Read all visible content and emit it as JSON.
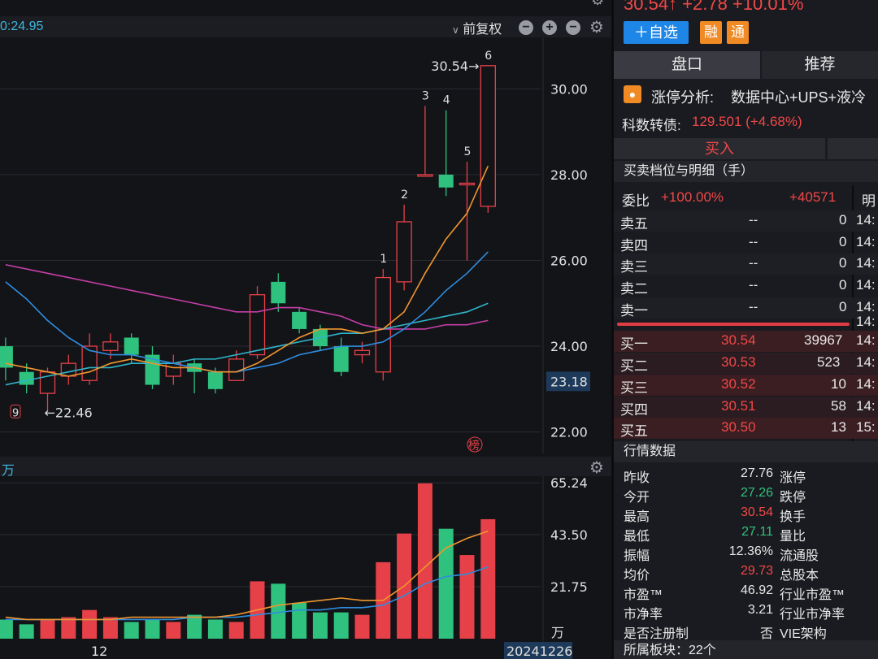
{
  "toolbar": {
    "left_value": "0:24.95",
    "adjust_label": "前复权",
    "settings_icon": "gear-icon"
  },
  "chart": {
    "y_ticks": [
      "30.00",
      "28.00",
      "26.00",
      "24.00",
      "22.00"
    ],
    "current_price_label": "23.18",
    "high_marker": "30.54",
    "low_marker": "22.46",
    "candle_number_labels": [
      "1",
      "2",
      "3",
      "4",
      "5",
      "6"
    ],
    "nine_label": "9",
    "bang_label": "榜",
    "volume_unit": "万",
    "volume_header_unit": "万",
    "volume_ticks": [
      "65.24",
      "43.50",
      "21.75"
    ],
    "x_label": "12",
    "date_label": "20241226"
  },
  "chart_data": {
    "type": "candlestick",
    "candles": [
      {
        "open": 24.0,
        "close": 23.5,
        "high": 24.2,
        "low": 23.2
      },
      {
        "open": 23.4,
        "close": 23.1,
        "high": 23.6,
        "low": 22.9
      },
      {
        "open": 22.9,
        "close": 23.4,
        "high": 23.5,
        "low": 22.5
      },
      {
        "open": 23.3,
        "close": 23.6,
        "high": 23.8,
        "low": 23.1
      },
      {
        "open": 23.2,
        "close": 24.0,
        "high": 24.3,
        "low": 23.1
      },
      {
        "open": 23.9,
        "close": 24.1,
        "high": 24.3,
        "low": 23.7
      },
      {
        "open": 24.2,
        "close": 23.8,
        "high": 24.3,
        "low": 23.6
      },
      {
        "open": 23.8,
        "close": 23.1,
        "high": 24.0,
        "low": 23.0
      },
      {
        "open": 23.3,
        "close": 23.6,
        "high": 23.8,
        "low": 23.1
      },
      {
        "open": 23.6,
        "close": 23.4,
        "high": 23.7,
        "low": 22.9
      },
      {
        "open": 23.4,
        "close": 23.0,
        "high": 23.5,
        "low": 22.9
      },
      {
        "open": 23.2,
        "close": 23.7,
        "high": 23.9,
        "low": 23.2
      },
      {
        "open": 23.8,
        "close": 25.2,
        "high": 25.4,
        "low": 23.7
      },
      {
        "open": 25.5,
        "close": 25.0,
        "high": 25.7,
        "low": 24.8
      },
      {
        "open": 24.8,
        "close": 24.4,
        "high": 24.9,
        "low": 24.3
      },
      {
        "open": 24.4,
        "close": 24.0,
        "high": 24.5,
        "low": 23.9
      },
      {
        "open": 24.0,
        "close": 23.4,
        "high": 24.2,
        "low": 23.3
      },
      {
        "open": 23.8,
        "close": 23.9,
        "high": 24.1,
        "low": 23.6
      },
      {
        "open": 23.4,
        "close": 25.6,
        "high": 25.8,
        "low": 23.2
      },
      {
        "open": 25.5,
        "close": 26.9,
        "high": 27.3,
        "low": 25.3
      },
      {
        "open": 28.0,
        "close": 28.0,
        "high": 29.6,
        "low": 28.0
      },
      {
        "open": 28.0,
        "close": 27.7,
        "high": 29.5,
        "low": 27.5
      },
      {
        "open": 27.8,
        "close": 27.8,
        "high": 28.3,
        "low": 26.0
      },
      {
        "open": 27.26,
        "close": 30.54,
        "high": 30.54,
        "low": 27.11
      }
    ],
    "ma_orange": [
      23.6,
      23.5,
      23.4,
      23.3,
      23.4,
      23.6,
      23.7,
      23.6,
      23.5,
      23.5,
      23.4,
      23.4,
      23.6,
      23.9,
      24.2,
      24.4,
      24.4,
      24.3,
      24.4,
      24.8,
      25.7,
      26.5,
      27.1,
      28.2
    ],
    "ma_blue": [
      25.5,
      25.1,
      24.6,
      24.2,
      23.9,
      23.8,
      23.8,
      23.7,
      23.6,
      23.5,
      23.4,
      23.4,
      23.5,
      23.6,
      23.8,
      23.9,
      24.0,
      24.0,
      24.1,
      24.4,
      24.8,
      25.3,
      25.7,
      26.2
    ],
    "ma_teal": [
      23.1,
      23.2,
      23.3,
      23.4,
      23.5,
      23.5,
      23.6,
      23.6,
      23.6,
      23.7,
      23.7,
      23.8,
      23.9,
      24.0,
      24.1,
      24.2,
      24.3,
      24.3,
      24.4,
      24.5,
      24.6,
      24.7,
      24.8,
      25.0
    ],
    "ma_magenta": [
      25.9,
      25.8,
      25.7,
      25.6,
      25.5,
      25.4,
      25.3,
      25.2,
      25.1,
      25.0,
      24.9,
      24.8,
      24.8,
      24.9,
      24.9,
      24.8,
      24.7,
      24.5,
      24.4,
      24.4,
      24.4,
      24.5,
      24.5,
      24.6
    ],
    "volumes": [
      8,
      6,
      8,
      9,
      12,
      9,
      7,
      8,
      7,
      10,
      8,
      7,
      24,
      23,
      15,
      11,
      11,
      10,
      32,
      44,
      65,
      46,
      35,
      50
    ],
    "volume_ma_orange": [
      9,
      8,
      8,
      8,
      8,
      8,
      9,
      9,
      9,
      9,
      9,
      10,
      12,
      14,
      15,
      16,
      17,
      16,
      16,
      22,
      30,
      38,
      42,
      45
    ],
    "volume_ma_blue": [
      8,
      8,
      8,
      8,
      8,
      8,
      8,
      8,
      8,
      9,
      9,
      9,
      10,
      11,
      12,
      12,
      13,
      13,
      14,
      18,
      23,
      26,
      27,
      30
    ],
    "price_ylim": [
      21.5,
      31.2
    ],
    "volume_ylim": [
      0,
      68
    ]
  },
  "header": {
    "price_line": "30.54↑ +2.78 +10.01%",
    "fav_button": "＋自选",
    "rong_button": "融",
    "tong_button": "通"
  },
  "tabs": [
    "盘口",
    "推荐"
  ],
  "analysis": {
    "label": "涨停分析:",
    "text": "数据中心+UPS+液冷"
  },
  "bond": {
    "label": "科数转债:",
    "value": "129.501 (+4.68%)"
  },
  "buy_tab": "买入",
  "depth_title": "买卖档位与明细（手）",
  "weibi": {
    "label": "委比",
    "value": "+100.00%",
    "diff": "+40571",
    "detail_label": "明"
  },
  "asks": [
    {
      "label": "卖五",
      "price": "--",
      "vol": "0",
      "time": "14:"
    },
    {
      "label": "卖四",
      "price": "--",
      "vol": "0",
      "time": "14:"
    },
    {
      "label": "卖三",
      "price": "--",
      "vol": "0",
      "time": "14:"
    },
    {
      "label": "卖二",
      "price": "--",
      "vol": "0",
      "time": "14:"
    },
    {
      "label": "卖一",
      "price": "--",
      "vol": "0",
      "time": "14:"
    }
  ],
  "bids": [
    {
      "label": "买一",
      "price": "30.54",
      "vol": "39967",
      "time": "14:"
    },
    {
      "label": "买二",
      "price": "30.53",
      "vol": "523",
      "time": "14:"
    },
    {
      "label": "买三",
      "price": "30.52",
      "vol": "10",
      "time": "14:"
    },
    {
      "label": "买四",
      "price": "30.51",
      "vol": "58",
      "time": "14:"
    },
    {
      "label": "买五",
      "price": "30.50",
      "vol": "13",
      "time": "15:"
    }
  ],
  "mid_time": "14:",
  "quote_title": "行情数据",
  "quotes": [
    {
      "label": "昨收",
      "value": "27.76",
      "color": "white",
      "right": "涨停"
    },
    {
      "label": "今开",
      "value": "27.26",
      "color": "green",
      "right": "跌停"
    },
    {
      "label": "最高",
      "value": "30.54",
      "color": "red",
      "right": "换手"
    },
    {
      "label": "最低",
      "value": "27.11",
      "color": "green",
      "right": "量比"
    },
    {
      "label": "振幅",
      "value": "12.36%",
      "color": "white",
      "right": "流通股"
    },
    {
      "label": "均价",
      "value": "29.73",
      "color": "red",
      "right": "总股本"
    },
    {
      "label": "市盈™",
      "value": "46.92",
      "color": "white",
      "right": "行业市盈™"
    },
    {
      "label": "市净率",
      "value": "3.21",
      "color": "white",
      "right": "行业市净率"
    },
    {
      "label": "是否注册制",
      "value": "否",
      "color": "white",
      "right": "VIE架构"
    }
  ],
  "sector": "所属板块：22个"
}
